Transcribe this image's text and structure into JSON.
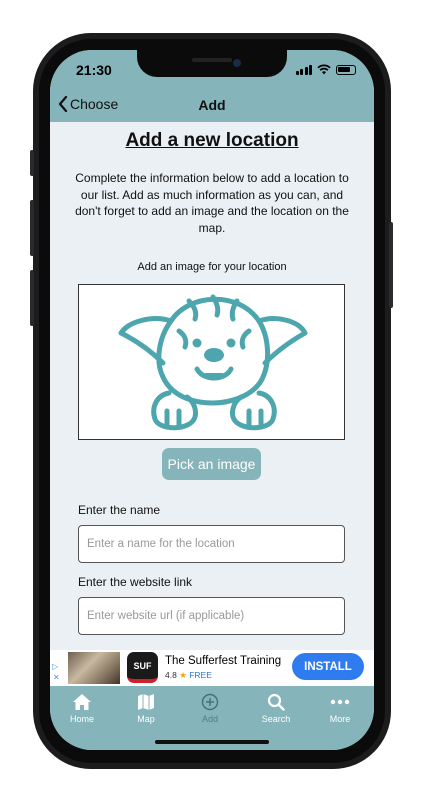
{
  "status_bar": {
    "time": "21:30"
  },
  "nav": {
    "back_label": "Choose",
    "title": "Add"
  },
  "form": {
    "heading": "Add a new location",
    "intro": "Complete the information below to add a location to our list. Add as much information as you can, and don't forget to add an image and the location on the map.",
    "image_label": "Add an image for your location",
    "pick_image_label": "Pick an image",
    "name_label": "Enter the name",
    "name_placeholder": "Enter a name for the location",
    "name_value": "",
    "website_label": "Enter the website link",
    "website_placeholder": "Enter website url (if applicable)",
    "website_value": ""
  },
  "ad": {
    "logo_text": "SUF",
    "title": "The Sufferfest Training",
    "rating": "4.8",
    "price": "FREE",
    "install_label": "INSTALL"
  },
  "tabs": [
    {
      "label": "Home",
      "icon": "house-icon",
      "active": true
    },
    {
      "label": "Map",
      "icon": "map-icon",
      "active": true
    },
    {
      "label": "Add",
      "icon": "plus-circle-icon",
      "active": false
    },
    {
      "label": "Search",
      "icon": "magnifier-icon",
      "active": true
    },
    {
      "label": "More",
      "icon": "ellipsis-icon",
      "active": true
    }
  ],
  "colors": {
    "accent": "#85b4ba",
    "background": "#eaf0f3",
    "dog_illustration": "#4da6ad",
    "install_button": "#2f7bf0"
  }
}
